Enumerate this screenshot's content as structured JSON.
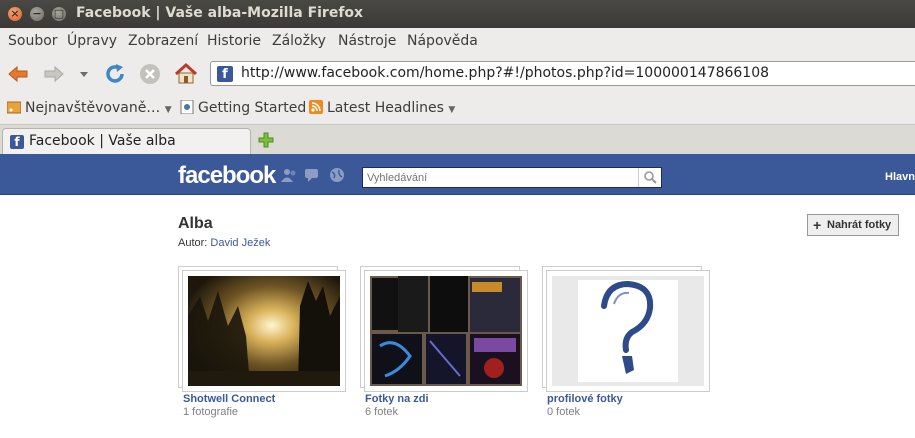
{
  "window": {
    "title": "Facebook | Vaše alba-Mozilla Firefox",
    "buttons": {
      "close": "×",
      "minimize": "−",
      "maximize": "□"
    }
  },
  "menu": [
    "Soubor",
    "Úpravy",
    "Zobrazení",
    "Historie",
    "Záložky",
    "Nástroje",
    "Nápověda"
  ],
  "nav": {
    "url": "http://www.facebook.com/home.php?#!/photos.php?id=100000147866108"
  },
  "bookmarks": [
    {
      "label": "Nejnavštěvovaně…",
      "icon": "rss-folder-icon"
    },
    {
      "label": "Getting Started",
      "icon": "page-icon"
    },
    {
      "label": "Latest Headlines",
      "icon": "rss-icon"
    }
  ],
  "tabs": [
    {
      "label": "Facebook | Vaše alba"
    }
  ],
  "facebook": {
    "logo": "facebook",
    "search_placeholder": "Vyhledávání",
    "home_link": "Hlavn",
    "brand_color": "#3b5998"
  },
  "page": {
    "title": "Alba",
    "author_prefix": "Autor:",
    "author_name": "David Ježek",
    "upload_button": "Nahrát fotky",
    "upload_plus": "+"
  },
  "albums": [
    {
      "name": "Shotwell Connect",
      "count": "1 fotografie"
    },
    {
      "name": "Fotky na zdi",
      "count": "6 fotek"
    },
    {
      "name": "profilové fotky",
      "count": "0 fotek"
    }
  ]
}
